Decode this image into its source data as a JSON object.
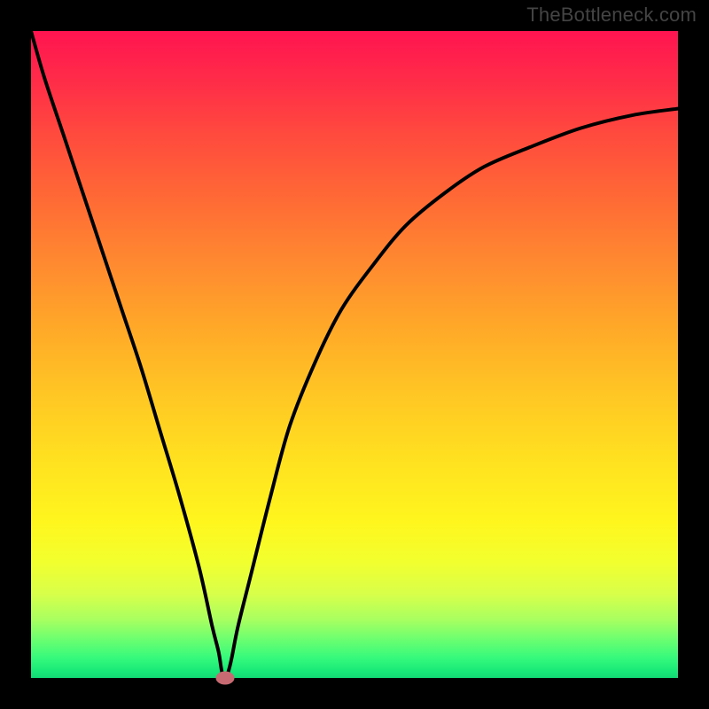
{
  "domain": "Chart",
  "watermark": "TheBottleneck.com",
  "colors": {
    "frame_background": "#000000",
    "gradient_top": "#ff1450",
    "gradient_mid": "#ffe020",
    "gradient_bottom": "#12d874",
    "curve_stroke": "#000000",
    "marker_fill": "#c76a72"
  },
  "chart_data": {
    "type": "line",
    "title": "",
    "xlabel": "",
    "ylabel": "",
    "xlim": [
      0,
      100
    ],
    "ylim": [
      0,
      100
    ],
    "grid": false,
    "legend": false,
    "series": [
      {
        "name": "bottleneck-curve",
        "x": [
          0,
          2,
          5,
          8,
          11,
          14,
          17,
          20,
          23,
          26,
          28,
          29,
          29.5,
          30,
          30.5,
          31,
          32,
          34,
          37,
          40,
          44,
          48,
          53,
          58,
          64,
          70,
          77,
          85,
          93,
          100
        ],
        "y": [
          100,
          93,
          84,
          75,
          66,
          57,
          48,
          38,
          28,
          17,
          8,
          4,
          1,
          0,
          1,
          3,
          8,
          16,
          28,
          39,
          49,
          57,
          64,
          70,
          75,
          79,
          82,
          85,
          87,
          88
        ]
      }
    ],
    "marker": {
      "name": "optimum-point",
      "x": 30,
      "y": 0,
      "shape": "ellipse"
    }
  }
}
